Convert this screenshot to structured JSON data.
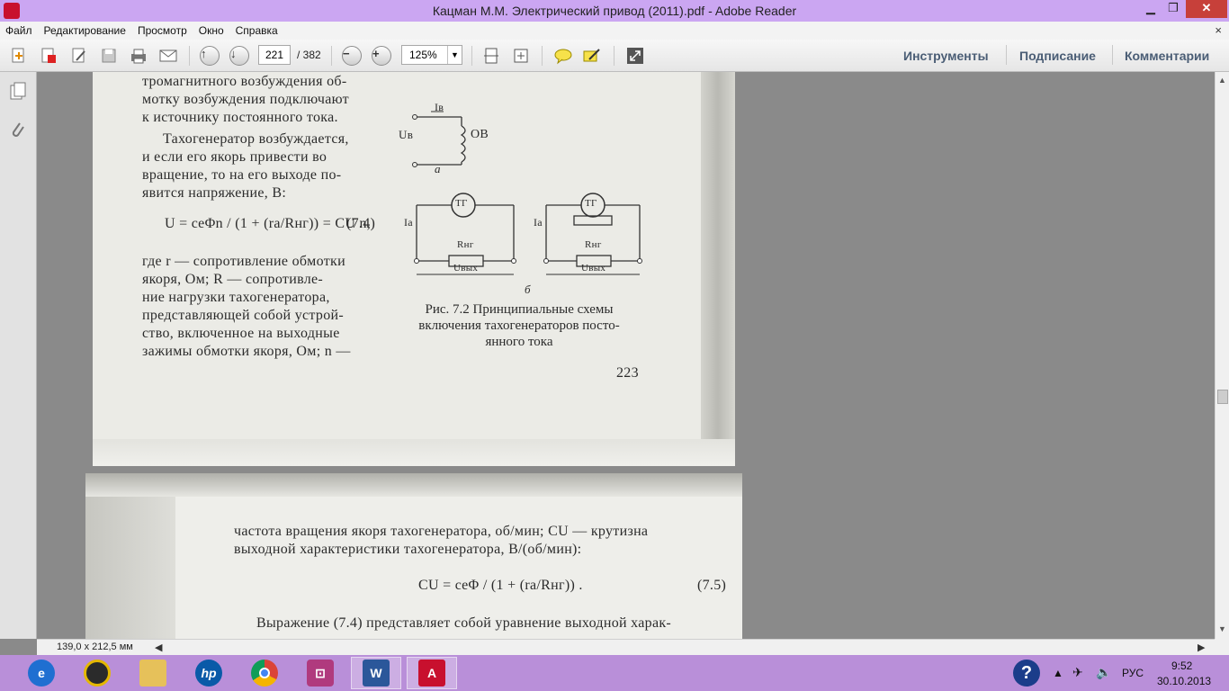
{
  "window": {
    "title": "Кацман М.М. Электрический привод (2011).pdf - Adobe Reader",
    "minimize_glyph": "▁",
    "maximize_glyph": "❐",
    "close_glyph": "✕"
  },
  "menu": {
    "items": [
      "Файл",
      "Редактирование",
      "Просмотр",
      "Окно",
      "Справка"
    ],
    "close_glyph": "×"
  },
  "toolbar": {
    "icons": [
      "create-pdf-icon",
      "export-icon",
      "edit-icon",
      "save-icon",
      "print-icon",
      "email-icon",
      "prev-page-icon",
      "next-page-icon",
      "zoom-out-icon",
      "zoom-in-icon",
      "fit-page-icon",
      "fit-width-icon",
      "comment-icon",
      "highlight-icon",
      "fullscreen-icon"
    ],
    "current_page": "221",
    "total_pages": "/ 382",
    "zoom": "125%",
    "right_links": {
      "tools": "Инструменты",
      "sign": "Подписание",
      "comments": "Комментарии"
    }
  },
  "nav_panel": {
    "icons": [
      "pages-icon",
      "attachments-icon"
    ]
  },
  "document": {
    "page1": {
      "left_text": [
        "тромагнитного возбуждения об-",
        "мотку возбуждения подключают",
        "к источнику постоянного тока.",
        "Тахогенератор возбуждается,",
        "и если его якорь привести во",
        "вращение, то на его выходе по-",
        "явится напряжение, В:",
        "где r — сопротивление обмотки",
        "якоря, Ом; R — сопротивле-",
        "ние нагрузки тахогенератора,",
        "представляющей собой устрой-",
        "ство, включенное на выходные",
        "зажимы обмотки якоря, Ом; n —"
      ],
      "formula": "U = cеΦn / (1 + (ra/Rнг)) = CU n,",
      "formula_number": "(7.4)",
      "diagram_labels": {
        "iv": "Iв",
        "uv": "Uв",
        "ov": "ОВ",
        "label_a": "а",
        "tg": "ТГ",
        "rng": "Rнг",
        "uvyh": "Uвых",
        "ia": "Iа",
        "label_b": "б"
      },
      "caption": [
        "Рис. 7.2 Принципиальные схемы",
        "включения тахогенераторов посто-",
        "янного тока"
      ],
      "page_number": "223"
    },
    "page2": {
      "lines": [
        "частота вращения якоря тахогенератора, об/мин; CU — крутизна",
        "выходной характеристики тахогенератора, В/(об/мин):"
      ],
      "formula": "CU = cеΦ / (1 + (ra/Rнг)) .",
      "formula_number": "(7.5)",
      "last_line": "Выражение (7.4) представляет собой уравнение выходной харак-"
    }
  },
  "status": {
    "page_size": "139,0 x 212,5 мм"
  },
  "taskbar": {
    "apps": [
      "ie-icon",
      "media-player-icon",
      "explorer-icon",
      "hp-icon",
      "chrome-icon",
      "remote-icon",
      "word-icon",
      "adobe-reader-icon"
    ],
    "tray": {
      "language": "РУС",
      "time": "9:52",
      "date": "30.10.2013"
    }
  }
}
